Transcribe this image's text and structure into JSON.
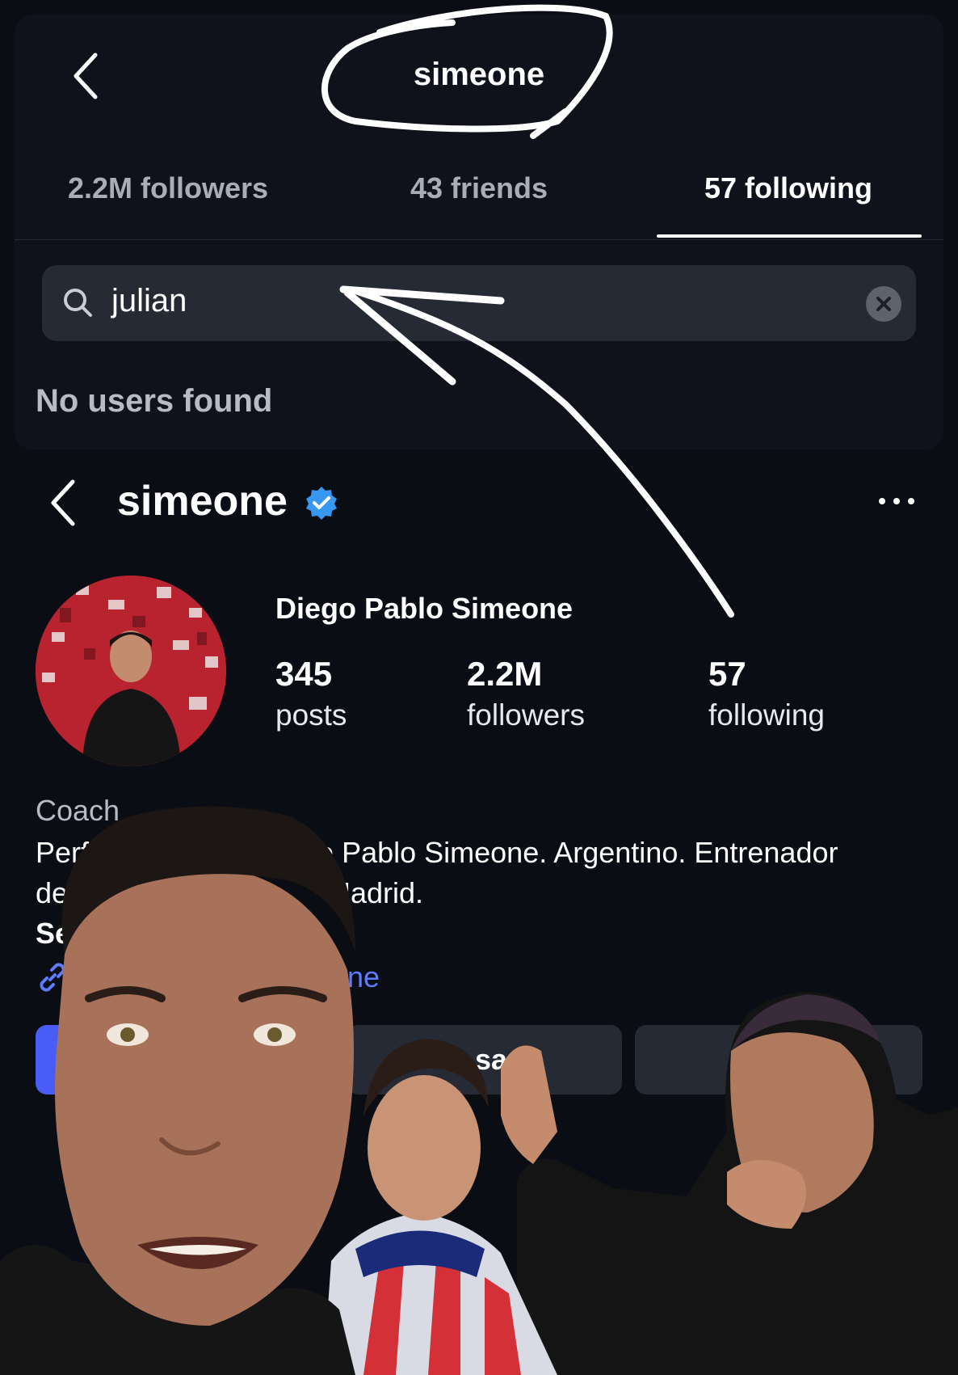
{
  "followers_sheet": {
    "title": "simeone",
    "tabs": [
      {
        "label": "2.2M followers",
        "active": false
      },
      {
        "label": "43 friends",
        "active": false
      },
      {
        "label": "57 following",
        "active": true
      }
    ],
    "search": {
      "value": "julian"
    },
    "empty_message": "No users found"
  },
  "profile": {
    "handle": "simeone",
    "verified": true,
    "full_name": "Diego Pablo Simeone",
    "stats": [
      {
        "value": "345",
        "label": "posts"
      },
      {
        "value": "2.2M",
        "label": "followers"
      },
      {
        "value": "57",
        "label": "following"
      }
    ],
    "category": "Coach",
    "bio_line1_start": "Perfil",
    "bio_line1_end": "iego Pablo Simeone. Argentino. Entrenador",
    "bio_line2_start": "del",
    "bio_line2_end": "Madrid.",
    "bio_line3_start": "Se",
    "link_fragment": "ne",
    "message_button_fragment": "sa e"
  },
  "colors": {
    "background": "#0a0d14",
    "panel": "#0f121b",
    "verified_badge": "#3897f0",
    "primary_button": "#4a5cf6"
  }
}
